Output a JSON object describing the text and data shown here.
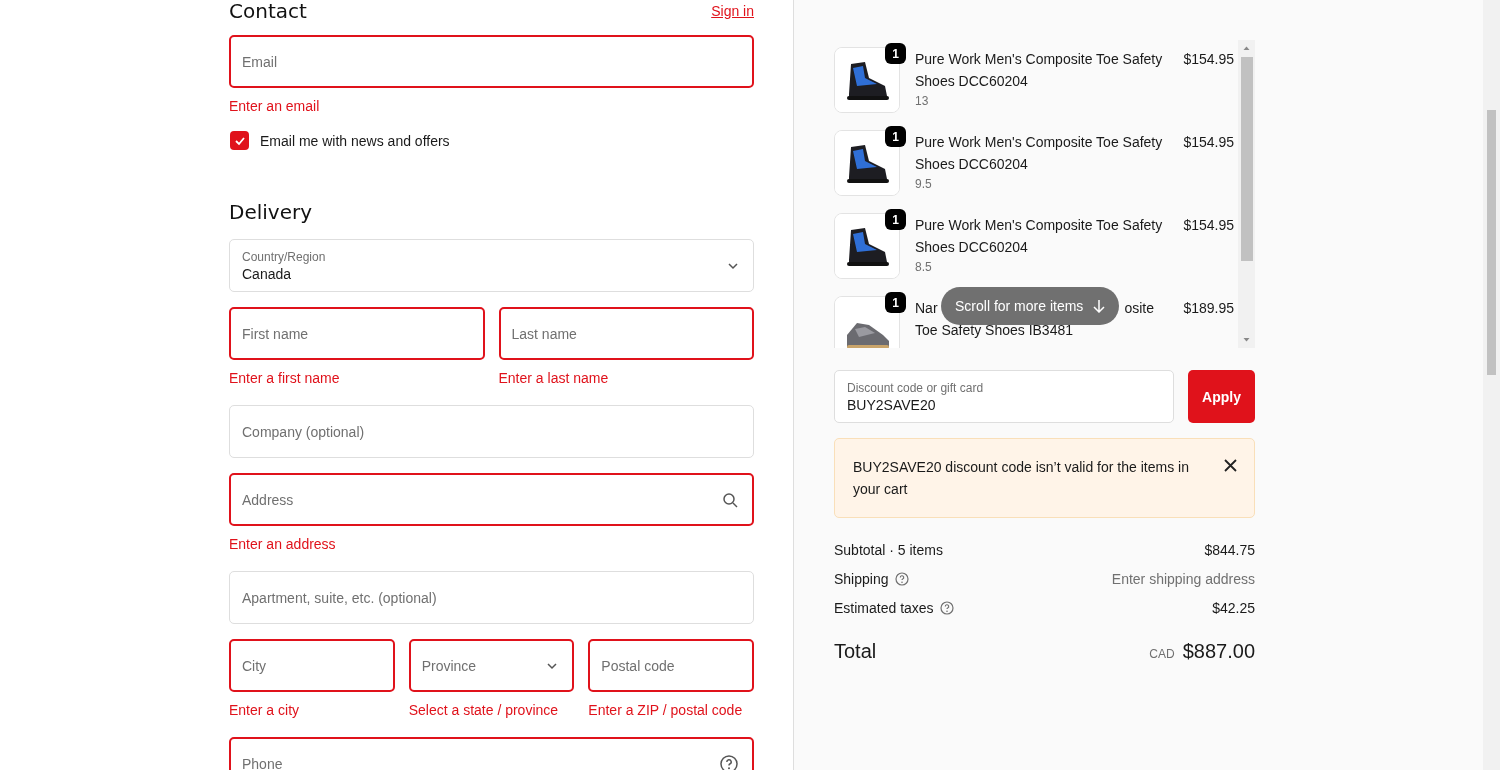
{
  "contact": {
    "heading": "Contact",
    "sign_in": "Sign in",
    "email": {
      "placeholder": "Email",
      "invalid": true,
      "error": "Enter an email"
    },
    "newsletter": {
      "label": "Email me with news and offers",
      "checked": true
    }
  },
  "delivery": {
    "heading": "Delivery",
    "rows": [
      [
        {
          "kind": "select",
          "label": "Country/Region",
          "value": "Canada",
          "invalid": false
        }
      ],
      [
        {
          "kind": "text",
          "placeholder": "First name",
          "invalid": true,
          "error": "Enter a first name"
        },
        {
          "kind": "text",
          "placeholder": "Last name",
          "invalid": true,
          "error": "Enter a last name"
        }
      ],
      [
        {
          "kind": "text",
          "placeholder": "Company (optional)",
          "invalid": false
        }
      ],
      [
        {
          "kind": "search",
          "placeholder": "Address",
          "invalid": true,
          "error": "Enter an address"
        }
      ],
      [
        {
          "kind": "text",
          "placeholder": "Apartment, suite, etc. (optional)",
          "invalid": false
        }
      ],
      [
        {
          "kind": "text",
          "placeholder": "City",
          "invalid": true,
          "error": "Enter a city"
        },
        {
          "kind": "select",
          "placeholder": "Province",
          "invalid": true,
          "error": "Select a state / province"
        },
        {
          "kind": "text",
          "placeholder": "Postal code",
          "invalid": true,
          "error": "Enter a ZIP / postal code"
        }
      ],
      [
        {
          "kind": "help",
          "placeholder": "Phone",
          "invalid": true
        }
      ]
    ]
  },
  "cart": {
    "items": [
      {
        "quantity": "1",
        "title": "Pure Work Men's Composite Toe Safety Shoes DCC60204",
        "variant": "13",
        "price": "$154.95"
      },
      {
        "quantity": "1",
        "title": "Pure Work Men's Composite Toe Safety Shoes DCC60204",
        "variant": "9.5",
        "price": "$154.95"
      },
      {
        "quantity": "1",
        "title": "Pure Work Men's Composite Toe Safety Shoes DCC60204",
        "variant": "8.5",
        "price": "$154.95"
      },
      {
        "quantity": "1",
        "title_start": "Nar",
        "title_end": "osite",
        "title_line2": "Toe Safety Shoes IB3481",
        "price": "$189.95"
      }
    ],
    "scroll_hint": "Scroll for more items"
  },
  "discount": {
    "label": "Discount code or gift card",
    "value": "BUY2SAVE20",
    "apply": "Apply"
  },
  "alert": {
    "message": "BUY2SAVE20 discount code isn’t valid for the items in your cart"
  },
  "summary": [
    {
      "label": "Subtotal · 5 items",
      "value": "$844.75",
      "help": false,
      "muted": false
    },
    {
      "label": "Shipping",
      "value": "Enter shipping address",
      "help": true,
      "muted": true
    },
    {
      "label": "Estimated taxes",
      "value": "$42.25",
      "help": true,
      "muted": false
    }
  ],
  "total": {
    "label": "Total",
    "currency": "CAD",
    "value": "$887.00"
  }
}
